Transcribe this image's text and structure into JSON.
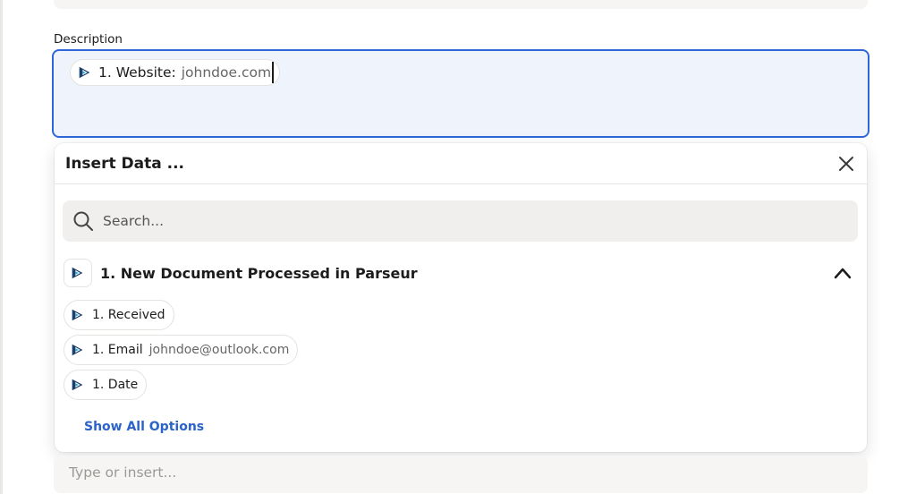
{
  "description": {
    "label": "Description",
    "token": {
      "key": "1. Website:",
      "value": "johndoe.com",
      "icon": "parseur-logo-icon"
    }
  },
  "insert_panel": {
    "title": "Insert Data ...",
    "close_icon": "close-icon",
    "search": {
      "placeholder": "Search...",
      "icon": "search-icon"
    },
    "group": {
      "title": "1. New Document Processed in Parseur",
      "icon": "parseur-logo-icon",
      "toggle_icon": "chevron-up-icon"
    },
    "options": [
      {
        "key": "1. Received",
        "value": ""
      },
      {
        "key": "1. Email",
        "value": "johndoe@outlook.com"
      },
      {
        "key": "1. Date",
        "value": ""
      }
    ],
    "show_all": "Show All Options"
  },
  "next_field": {
    "placeholder": "Type or insert..."
  },
  "colors": {
    "accent": "#3067d8",
    "link": "#2a63c9",
    "logo_dark": "#1b3f6b",
    "logo_light": "#2fa6d6",
    "field_bg": "#f6f5f3",
    "focused_bg": "#eef3fc"
  }
}
